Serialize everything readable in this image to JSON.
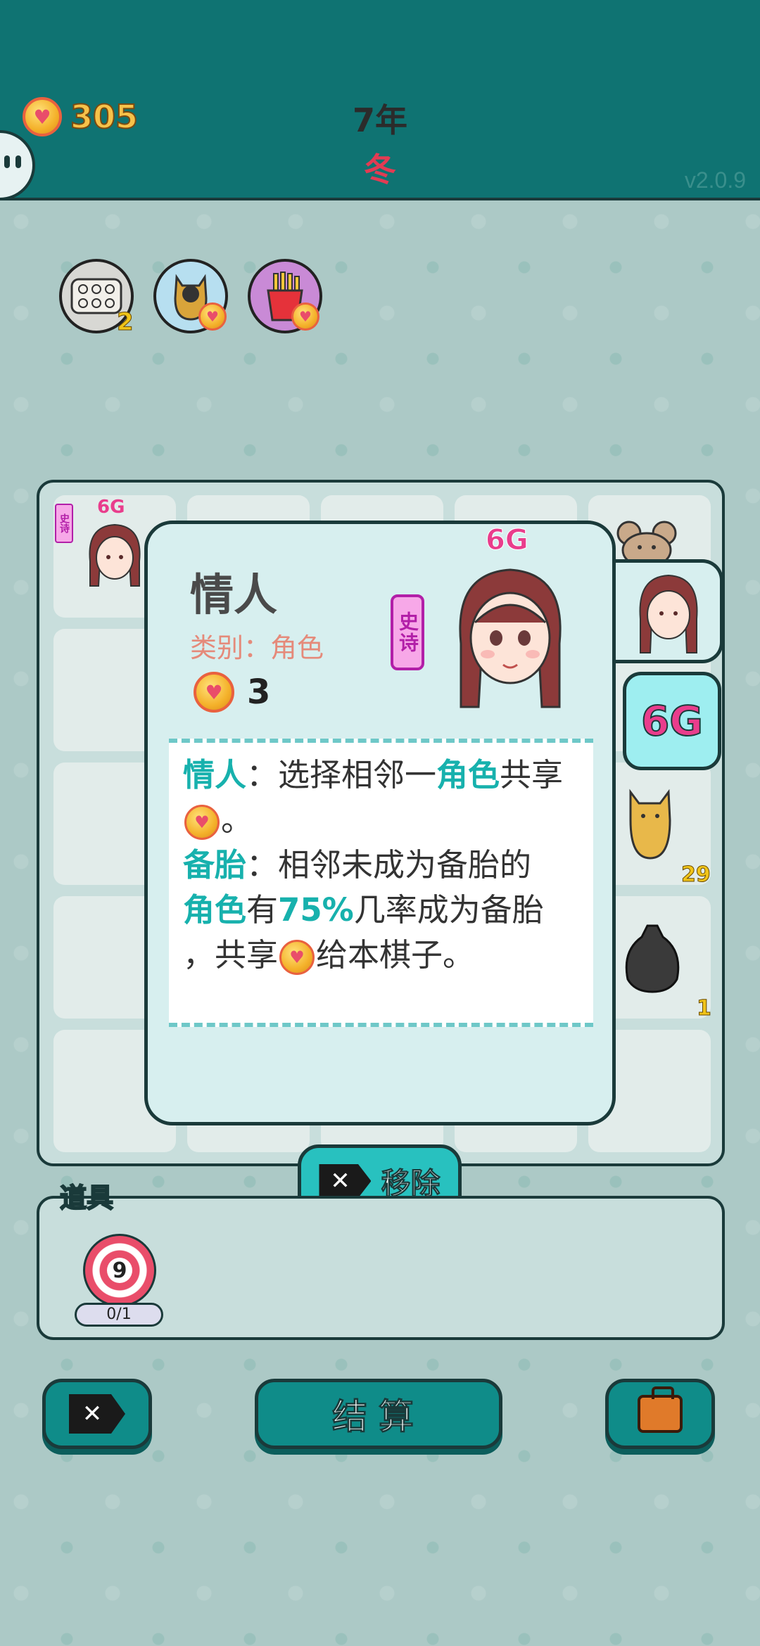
{
  "top": {
    "coins": "305",
    "year": "7年",
    "season": "冬",
    "version": "v2.0.9"
  },
  "items": [
    {
      "icon": "egg-tray-icon",
      "badge": "2",
      "color": "#d8d8d4"
    },
    {
      "icon": "cat-silhouette-icon",
      "badge": "",
      "color": "#b7dff0"
    },
    {
      "icon": "fries-icon",
      "badge": "",
      "color": "#c98ad6"
    }
  ],
  "board": {
    "mini_grade": "6G",
    "mini_rarity": "史诗",
    "cat_count": "29",
    "trash_count": "1"
  },
  "popup": {
    "name": "情人",
    "category": "类别：角色",
    "cost": "3",
    "rarity": "史诗",
    "grade": "6G",
    "desc": {
      "l1a": "情人",
      "l1b": "：选择相邻一",
      "l1c": "角色",
      "l1d": "共享",
      "l2": "。",
      "l3a": "备胎",
      "l3b": "：相邻未成为备胎的",
      "l4a": "角色",
      "l4b": "有",
      "l4c": "75%",
      "l4d": "几率成为备胎",
      "l5a": "，共享",
      "l5b": "给本棋子。"
    }
  },
  "side": {
    "grade": "6G"
  },
  "remove_button": "移除",
  "tools": {
    "label": "道具",
    "target_value": "9",
    "count": "0/1"
  },
  "bottom": {
    "settle": "结算"
  },
  "colors": {
    "topbar": "#0f7372",
    "accent": "#17b1ad",
    "rarity": "#b21fa8",
    "grade": "#e93d8c"
  }
}
